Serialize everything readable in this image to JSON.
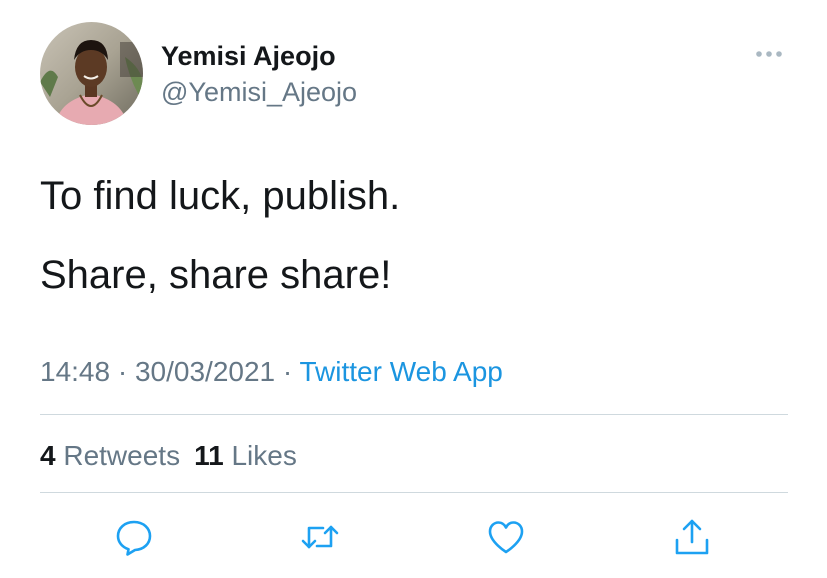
{
  "user": {
    "display_name": "Yemisi Ajeojo",
    "handle": "@Yemisi_Ajeojo"
  },
  "tweet": {
    "lines": [
      "To find luck, publish.",
      "Share, share share!"
    ],
    "time": "14:48",
    "separator": " · ",
    "date": "30/03/2021",
    "source": "Twitter Web App"
  },
  "stats": {
    "retweets_count": "4",
    "retweets_label": "Retweets",
    "likes_count": "11",
    "likes_label": "Likes"
  },
  "icons": {
    "more": "more-horizontal-icon",
    "reply": "reply-bubble-icon",
    "retweet": "retweet-icon",
    "like": "heart-icon",
    "share": "share-upload-icon"
  },
  "colors": {
    "accent": "#1b95e0",
    "secondary_text": "#657786",
    "primary_text": "#14171a",
    "action_icon": "#1da1f2",
    "divider": "#cfd9de"
  }
}
